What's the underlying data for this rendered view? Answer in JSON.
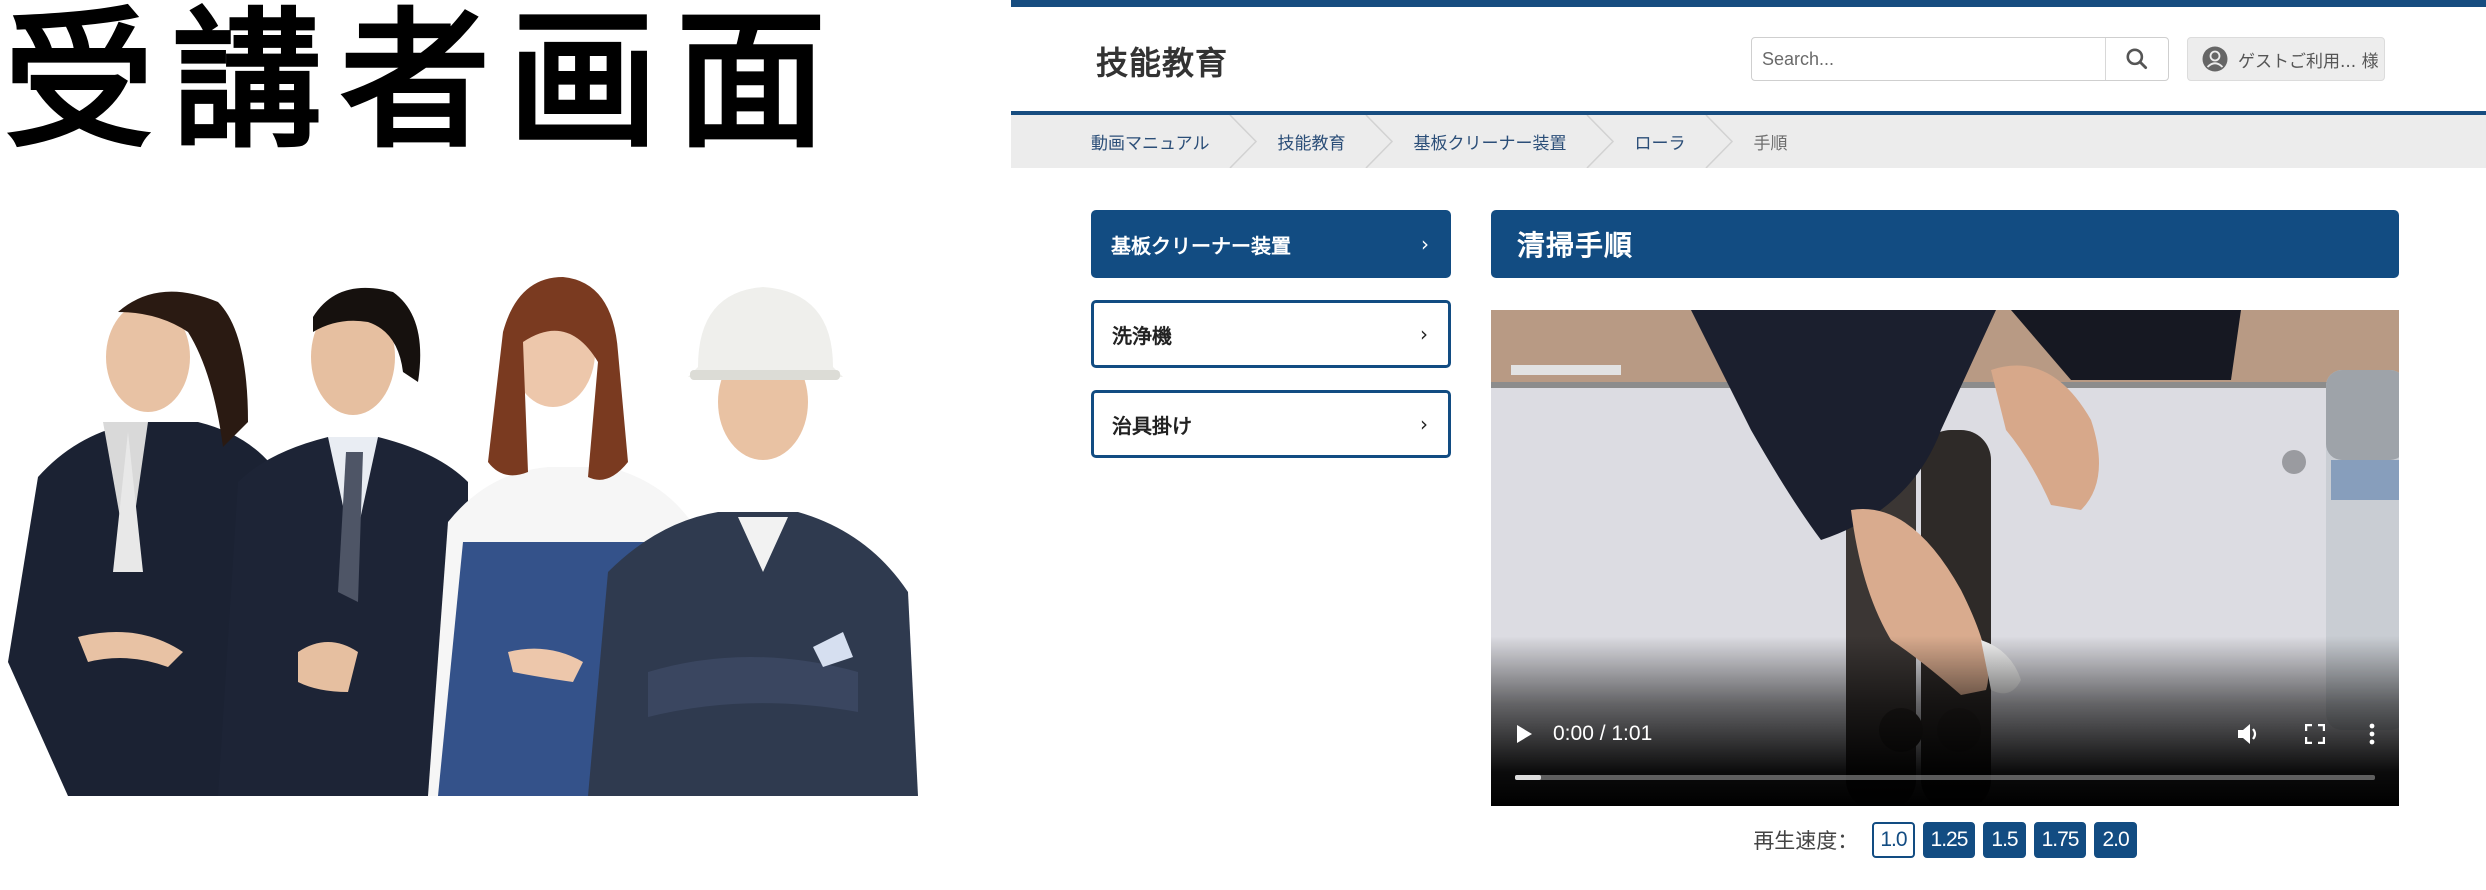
{
  "promo": {
    "title": "受講者画面",
    "image_description": "Four smiling professionals: woman in business suit, man in suit and tie, woman in denim apron, worker in hard hat and work uniform"
  },
  "header": {
    "site_title": "技能教育",
    "search": {
      "placeholder": "Search...",
      "value": "",
      "button_icon": "search-icon"
    },
    "user": {
      "icon": "user-avatar-icon",
      "label": "ゲストご利用... 様"
    }
  },
  "breadcrumb": {
    "items": [
      {
        "label": "動画マニュアル",
        "current": false
      },
      {
        "label": "技能教育",
        "current": false
      },
      {
        "label": "基板クリーナー装置",
        "current": false
      },
      {
        "label": "ローラ",
        "current": false
      },
      {
        "label": "手順",
        "current": true
      }
    ]
  },
  "sidebar": {
    "items": [
      {
        "label": "基板クリーナー装置",
        "active": true,
        "icon": "chevron-right-icon"
      },
      {
        "label": "洗浄機",
        "active": false,
        "icon": "chevron-right-icon"
      },
      {
        "label": "治具掛け",
        "active": false,
        "icon": "chevron-right-icon"
      }
    ],
    "chevron": "›"
  },
  "content": {
    "title": "清掃手順",
    "video": {
      "current_time": "0:00",
      "duration": "1:01",
      "time_display": "0:00 / 1:01",
      "progress_fraction": 0.0,
      "controls": [
        "play-icon",
        "volume-icon",
        "fullscreen-icon",
        "more-options-icon"
      ],
      "frame_description": "Hands wiping a dark roller with a white cloth on a white machine; spray can at right"
    },
    "speed": {
      "label": "再生速度：",
      "options": [
        "1.0",
        "1.25",
        "1.5",
        "1.75",
        "2.0"
      ],
      "selected": "1.0"
    }
  },
  "colors": {
    "brand": "#124c82",
    "top_bar": "#174d80",
    "breadcrumb_bg": "#ececec",
    "breadcrumb_link": "#2b4e78",
    "breadcrumb_current": "#6e6e6e"
  }
}
